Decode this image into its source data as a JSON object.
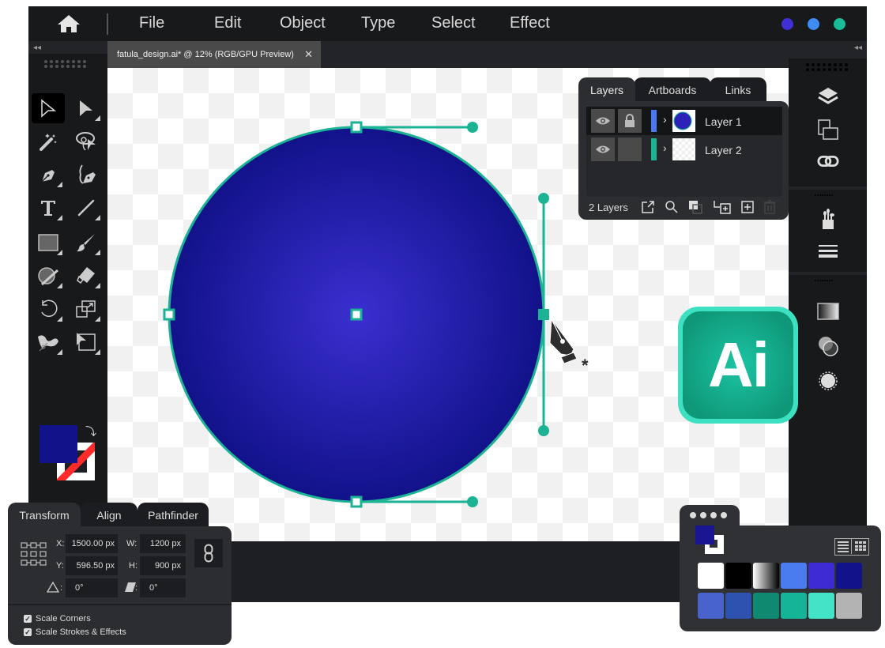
{
  "menubar": {
    "home_icon": "home-icon",
    "items": [
      "File",
      "Edit",
      "Object",
      "Type",
      "Select",
      "Effect"
    ],
    "window_dots": [
      "#3f2fd4",
      "#3f8cf5",
      "#1bbc98"
    ]
  },
  "document_tab": {
    "title": "fatula_design.ai* @ 12% (RGB/GPU Preview)",
    "close": "✕"
  },
  "collapse_glyph": "◂◂",
  "toolbar": {
    "tools": [
      {
        "name": "selection-tool",
        "icon": "arrow-outline-icon"
      },
      {
        "name": "direct-selection-tool",
        "icon": "arrow-filled-icon"
      },
      {
        "name": "magic-wand-tool",
        "icon": "magic-wand-icon"
      },
      {
        "name": "lasso-tool",
        "icon": "lasso-icon"
      },
      {
        "name": "pen-tool",
        "icon": "pen-icon"
      },
      {
        "name": "curvature-tool",
        "icon": "curvature-pen-icon"
      },
      {
        "name": "type-tool",
        "icon": "type-icon"
      },
      {
        "name": "line-tool",
        "icon": "line-icon"
      },
      {
        "name": "rectangle-tool",
        "icon": "rectangle-icon"
      },
      {
        "name": "paintbrush-tool",
        "icon": "brush-icon"
      },
      {
        "name": "shaper-tool",
        "icon": "shaper-icon"
      },
      {
        "name": "eraser-tool",
        "icon": "eraser-icon"
      },
      {
        "name": "rotate-tool",
        "icon": "rotate-icon"
      },
      {
        "name": "scale-tool",
        "icon": "scale-icon"
      },
      {
        "name": "warp-tool",
        "icon": "warp-icon"
      },
      {
        "name": "free-transform-tool",
        "icon": "free-transform-icon"
      }
    ],
    "fill_color": "#12128a",
    "stroke_color": "none"
  },
  "canvas": {
    "shape_fill_center": "#3a2fd0",
    "shape_fill_edge": "#12128a",
    "path_color": "#1bb394"
  },
  "layers_panel": {
    "tabs": [
      "Layers",
      "Artboards",
      "Links"
    ],
    "active_tab": "Layers",
    "layers": [
      {
        "name": "Layer 1",
        "color": "#4a78f0",
        "locked": true,
        "visible": true,
        "selected": true
      },
      {
        "name": "Layer 2",
        "color": "#1bb394",
        "locked": false,
        "visible": true,
        "selected": false
      }
    ],
    "count_label": "2 Layers"
  },
  "right_panel": {
    "groups": [
      [
        "layers-icon",
        "artboards-icon",
        "links-icon"
      ],
      [
        "brushes-icon",
        "stroke-icon"
      ],
      [
        "gradient-icon",
        "transparency-icon",
        "appearance-icon"
      ]
    ]
  },
  "transform_panel": {
    "tabs": [
      "Transform",
      "Align",
      "Pathfinder"
    ],
    "active_tab": "Transform",
    "x_label": "X:",
    "x": "1500.00 px",
    "y_label": "Y:",
    "y": "596.50 px",
    "w_label": "W:",
    "w": "1200 px",
    "h_label": "H:",
    "h": "900 px",
    "rotate_label": ":",
    "rotate": "0°",
    "shear_label": ":",
    "shear": "0°",
    "checkboxes": [
      {
        "label": "Scale Corners",
        "checked": true
      },
      {
        "label": "Scale Strokes & Effects",
        "checked": true
      }
    ]
  },
  "swatches_panel": {
    "fill_color": "#1a1590",
    "row1": [
      "#ffffff",
      "#000000",
      "gradient-white-black",
      "#4a7cf0",
      "#3f2bd3",
      "#12128a"
    ],
    "row2": [
      "#4864cc",
      "#2d52b0",
      "#0f8a70",
      "#16b497",
      "#42e3c6",
      "#b3b3b3"
    ]
  },
  "brand_logo": {
    "text": "Ai"
  }
}
